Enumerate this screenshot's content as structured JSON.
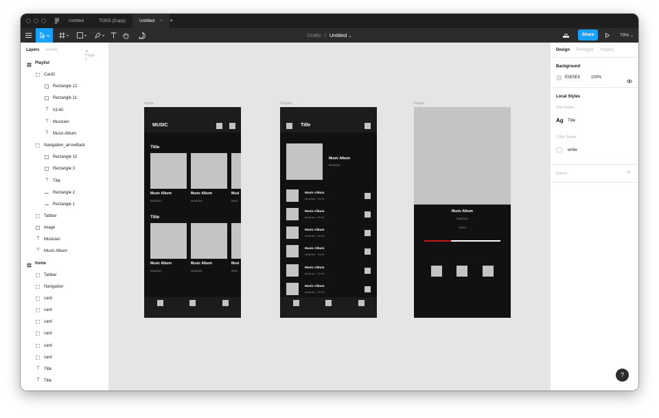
{
  "tabs": [
    {
      "label": "Untitled"
    },
    {
      "label": "TOSS (Copy)"
    },
    {
      "label": "Untitled"
    }
  ],
  "toolbar": {
    "breadcrumb": "Drafts",
    "separator": "/",
    "doc_title": "Untitled",
    "share_label": "Share",
    "zoom": "70%"
  },
  "left_panel": {
    "tab_layers": "Layers",
    "tab_assets": "Assets",
    "page_selector": "Page 1",
    "layers": [
      {
        "label": "Playlist",
        "type": "frame",
        "indent": 0
      },
      {
        "label": "Card2",
        "type": "group",
        "indent": 1
      },
      {
        "label": "Rectangle 12",
        "type": "rect",
        "indent": 2
      },
      {
        "label": "Rectangle 11",
        "type": "rect",
        "indent": 2
      },
      {
        "label": "03:40",
        "type": "text",
        "indent": 2
      },
      {
        "label": "Musician",
        "type": "text",
        "indent": 2
      },
      {
        "label": "Music Album",
        "type": "text",
        "indent": 2
      },
      {
        "label": "Navigation_arrowBack",
        "type": "group",
        "indent": 1
      },
      {
        "label": "Rectangle 10",
        "type": "rect",
        "indent": 2
      },
      {
        "label": "Rectangle 3",
        "type": "rect",
        "indent": 2
      },
      {
        "label": "Title",
        "type": "text",
        "indent": 2
      },
      {
        "label": "Rectangle 2",
        "type": "line",
        "indent": 2
      },
      {
        "label": "Rectangle 1",
        "type": "line",
        "indent": 2
      },
      {
        "label": "Tabbar",
        "type": "group",
        "indent": 1
      },
      {
        "label": "image",
        "type": "rect",
        "indent": 1
      },
      {
        "label": "Musician",
        "type": "text",
        "indent": 1
      },
      {
        "label": "Music Album",
        "type": "text",
        "indent": 1
      },
      {
        "label": "home",
        "type": "frame",
        "indent": 0
      },
      {
        "label": "Tabbar",
        "type": "group",
        "indent": 1
      },
      {
        "label": "Navigation",
        "type": "group",
        "indent": 1
      },
      {
        "label": "card",
        "type": "group",
        "indent": 1
      },
      {
        "label": "card",
        "type": "group",
        "indent": 1
      },
      {
        "label": "card",
        "type": "group",
        "indent": 1
      },
      {
        "label": "card",
        "type": "group",
        "indent": 1
      },
      {
        "label": "card",
        "type": "group",
        "indent": 1
      },
      {
        "label": "card",
        "type": "group",
        "indent": 1
      },
      {
        "label": "Title",
        "type": "text",
        "indent": 1
      },
      {
        "label": "Title",
        "type": "text",
        "indent": 1
      }
    ]
  },
  "right_panel": {
    "tab_design": "Design",
    "tab_prototype": "Prototype",
    "tab_inspect": "Inspect",
    "background_title": "Background",
    "background_hex": "E5E5E5",
    "background_opacity": "100%",
    "local_styles_title": "Local Styles",
    "text_styles_label": "Text Styles",
    "text_style_sample": "Ag",
    "text_style_name": "Title",
    "color_styles_label": "Color Styles",
    "color_style_name": "white",
    "export_label": "Export",
    "export_add": "+"
  },
  "canvas": {
    "home": {
      "frame_label": "home",
      "header_title": "MUSIC",
      "section_title_1": "Title",
      "section_title_2": "Title",
      "card_title": "Music Album",
      "card_sub": "Musician",
      "card_title_cut": "Musi",
      "card_sub_cut": "Musi"
    },
    "playlist": {
      "frame_label": "Playlist",
      "header_title": "Title",
      "album_title": "Music Album",
      "album_sub": "Musician",
      "track_title": "Music Album",
      "track_sub": "Musician · 03:40"
    },
    "player": {
      "frame_label": "Player",
      "song_title": "Music Album",
      "song_artist": "Musician",
      "song_time": "03:40",
      "progress": 0.35
    }
  },
  "colors": {
    "accent": "#18a0fb",
    "progress": "#c41818",
    "frame_bg": "#111111",
    "placeholder": "#c4c4c4"
  },
  "help_label": "?"
}
